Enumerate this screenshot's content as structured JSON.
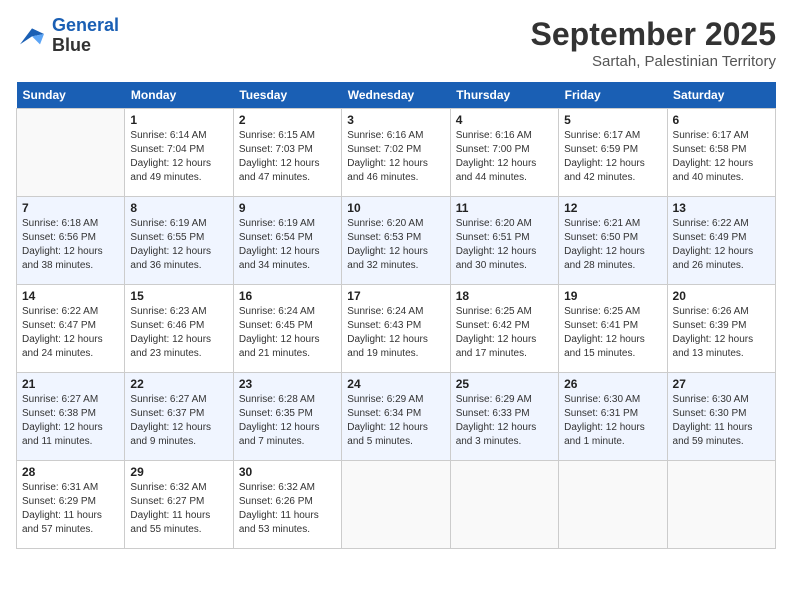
{
  "header": {
    "logo_line1": "General",
    "logo_line2": "Blue",
    "month": "September 2025",
    "location": "Sartah, Palestinian Territory"
  },
  "weekdays": [
    "Sunday",
    "Monday",
    "Tuesday",
    "Wednesday",
    "Thursday",
    "Friday",
    "Saturday"
  ],
  "weeks": [
    [
      {
        "day": "",
        "info": ""
      },
      {
        "day": "1",
        "info": "Sunrise: 6:14 AM\nSunset: 7:04 PM\nDaylight: 12 hours\nand 49 minutes."
      },
      {
        "day": "2",
        "info": "Sunrise: 6:15 AM\nSunset: 7:03 PM\nDaylight: 12 hours\nand 47 minutes."
      },
      {
        "day": "3",
        "info": "Sunrise: 6:16 AM\nSunset: 7:02 PM\nDaylight: 12 hours\nand 46 minutes."
      },
      {
        "day": "4",
        "info": "Sunrise: 6:16 AM\nSunset: 7:00 PM\nDaylight: 12 hours\nand 44 minutes."
      },
      {
        "day": "5",
        "info": "Sunrise: 6:17 AM\nSunset: 6:59 PM\nDaylight: 12 hours\nand 42 minutes."
      },
      {
        "day": "6",
        "info": "Sunrise: 6:17 AM\nSunset: 6:58 PM\nDaylight: 12 hours\nand 40 minutes."
      }
    ],
    [
      {
        "day": "7",
        "info": "Sunrise: 6:18 AM\nSunset: 6:56 PM\nDaylight: 12 hours\nand 38 minutes."
      },
      {
        "day": "8",
        "info": "Sunrise: 6:19 AM\nSunset: 6:55 PM\nDaylight: 12 hours\nand 36 minutes."
      },
      {
        "day": "9",
        "info": "Sunrise: 6:19 AM\nSunset: 6:54 PM\nDaylight: 12 hours\nand 34 minutes."
      },
      {
        "day": "10",
        "info": "Sunrise: 6:20 AM\nSunset: 6:53 PM\nDaylight: 12 hours\nand 32 minutes."
      },
      {
        "day": "11",
        "info": "Sunrise: 6:20 AM\nSunset: 6:51 PM\nDaylight: 12 hours\nand 30 minutes."
      },
      {
        "day": "12",
        "info": "Sunrise: 6:21 AM\nSunset: 6:50 PM\nDaylight: 12 hours\nand 28 minutes."
      },
      {
        "day": "13",
        "info": "Sunrise: 6:22 AM\nSunset: 6:49 PM\nDaylight: 12 hours\nand 26 minutes."
      }
    ],
    [
      {
        "day": "14",
        "info": "Sunrise: 6:22 AM\nSunset: 6:47 PM\nDaylight: 12 hours\nand 24 minutes."
      },
      {
        "day": "15",
        "info": "Sunrise: 6:23 AM\nSunset: 6:46 PM\nDaylight: 12 hours\nand 23 minutes."
      },
      {
        "day": "16",
        "info": "Sunrise: 6:24 AM\nSunset: 6:45 PM\nDaylight: 12 hours\nand 21 minutes."
      },
      {
        "day": "17",
        "info": "Sunrise: 6:24 AM\nSunset: 6:43 PM\nDaylight: 12 hours\nand 19 minutes."
      },
      {
        "day": "18",
        "info": "Sunrise: 6:25 AM\nSunset: 6:42 PM\nDaylight: 12 hours\nand 17 minutes."
      },
      {
        "day": "19",
        "info": "Sunrise: 6:25 AM\nSunset: 6:41 PM\nDaylight: 12 hours\nand 15 minutes."
      },
      {
        "day": "20",
        "info": "Sunrise: 6:26 AM\nSunset: 6:39 PM\nDaylight: 12 hours\nand 13 minutes."
      }
    ],
    [
      {
        "day": "21",
        "info": "Sunrise: 6:27 AM\nSunset: 6:38 PM\nDaylight: 12 hours\nand 11 minutes."
      },
      {
        "day": "22",
        "info": "Sunrise: 6:27 AM\nSunset: 6:37 PM\nDaylight: 12 hours\nand 9 minutes."
      },
      {
        "day": "23",
        "info": "Sunrise: 6:28 AM\nSunset: 6:35 PM\nDaylight: 12 hours\nand 7 minutes."
      },
      {
        "day": "24",
        "info": "Sunrise: 6:29 AM\nSunset: 6:34 PM\nDaylight: 12 hours\nand 5 minutes."
      },
      {
        "day": "25",
        "info": "Sunrise: 6:29 AM\nSunset: 6:33 PM\nDaylight: 12 hours\nand 3 minutes."
      },
      {
        "day": "26",
        "info": "Sunrise: 6:30 AM\nSunset: 6:31 PM\nDaylight: 12 hours\nand 1 minute."
      },
      {
        "day": "27",
        "info": "Sunrise: 6:30 AM\nSunset: 6:30 PM\nDaylight: 11 hours\nand 59 minutes."
      }
    ],
    [
      {
        "day": "28",
        "info": "Sunrise: 6:31 AM\nSunset: 6:29 PM\nDaylight: 11 hours\nand 57 minutes."
      },
      {
        "day": "29",
        "info": "Sunrise: 6:32 AM\nSunset: 6:27 PM\nDaylight: 11 hours\nand 55 minutes."
      },
      {
        "day": "30",
        "info": "Sunrise: 6:32 AM\nSunset: 6:26 PM\nDaylight: 11 hours\nand 53 minutes."
      },
      {
        "day": "",
        "info": ""
      },
      {
        "day": "",
        "info": ""
      },
      {
        "day": "",
        "info": ""
      },
      {
        "day": "",
        "info": ""
      }
    ]
  ]
}
